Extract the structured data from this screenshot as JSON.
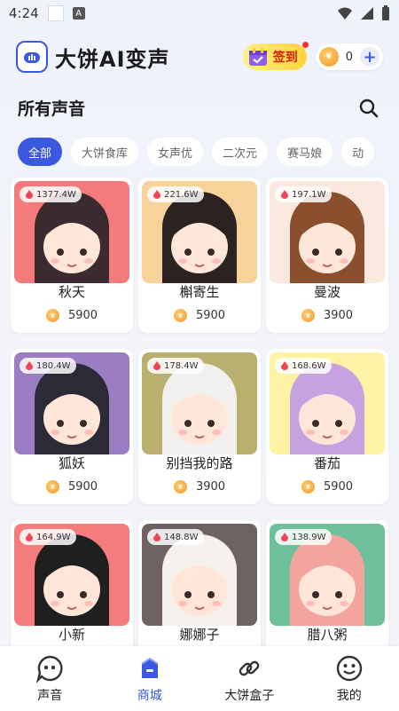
{
  "status_bar": {
    "time": "4:24",
    "mini_label": "A"
  },
  "header": {
    "title": "大饼AI变声",
    "checkin_label": "签到",
    "coin_count": "0",
    "coin_glyph": "¥"
  },
  "section": {
    "title": "所有声音"
  },
  "tabs": [
    {
      "label": "全部",
      "active": true
    },
    {
      "label": "大饼食库",
      "active": false
    },
    {
      "label": "女声优",
      "active": false
    },
    {
      "label": "二次元",
      "active": false
    },
    {
      "label": "赛马娘",
      "active": false
    },
    {
      "label": "动",
      "active": false
    }
  ],
  "voices": [
    {
      "heat": "1377.4W",
      "name": "秋天",
      "price": "5900",
      "bg": "#f47b7b",
      "hair": "#3b2a2f"
    },
    {
      "heat": "221.6W",
      "name": "槲寄生",
      "price": "5900",
      "bg": "#f7d29a",
      "hair": "#2c2221"
    },
    {
      "heat": "197.1W",
      "name": "曼波",
      "price": "3900",
      "bg": "#fbe9df",
      "hair": "#8a4f2c"
    },
    {
      "heat": "180.4W",
      "name": "狐妖",
      "price": "5900",
      "bg": "#9b7dc4",
      "hair": "#2d2a38"
    },
    {
      "heat": "178.4W",
      "name": "别挡我的路",
      "price": "3900",
      "bg": "#b9b070",
      "hair": "#f2f0ee"
    },
    {
      "heat": "168.6W",
      "name": "番茄",
      "price": "5900",
      "bg": "#fff3a6",
      "hair": "#c6a3e0"
    },
    {
      "heat": "164.9W",
      "name": "小新",
      "price": "",
      "bg": "#f47c7c",
      "hair": "#1f1f1f"
    },
    {
      "heat": "148.8W",
      "name": "娜娜子",
      "price": "",
      "bg": "#6e6262",
      "hair": "#f7f1ee"
    },
    {
      "heat": "138.9W",
      "name": "腊八粥",
      "price": "",
      "bg": "#6fbf9c",
      "hair": "#f2a49d"
    }
  ],
  "nav": [
    {
      "label": "声音",
      "icon": "chat-bubble-icon",
      "active": false
    },
    {
      "label": "商城",
      "icon": "shop-icon",
      "active": true
    },
    {
      "label": "大饼盒子",
      "icon": "link-icon",
      "active": false
    },
    {
      "label": "我的",
      "icon": "smile-face-icon",
      "active": false
    }
  ]
}
